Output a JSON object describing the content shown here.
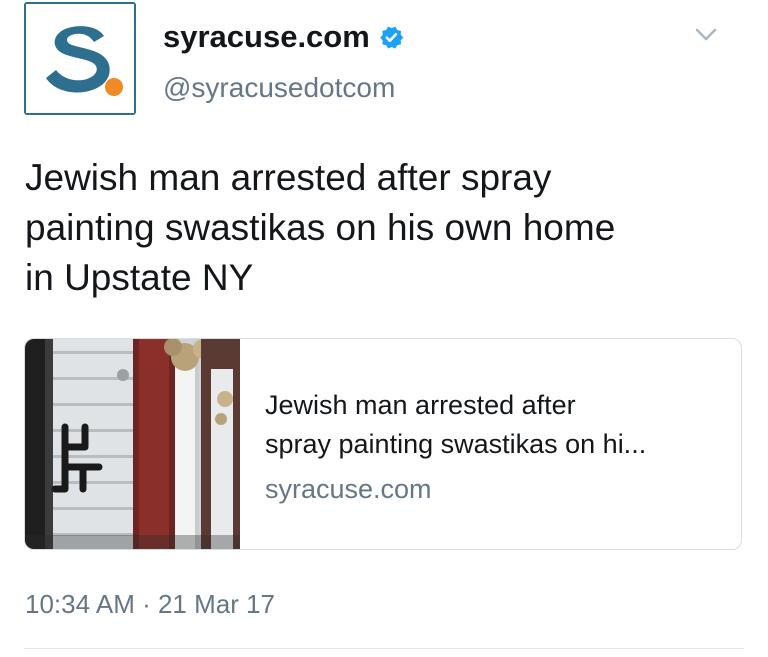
{
  "author": {
    "display_name": "syracuse.com",
    "handle": "@syracusedotcom",
    "verified": true,
    "avatar_icon": "syracuse-s-logo",
    "brand_color": "#2e6f8f",
    "accent_color": "#f08a24"
  },
  "tweet": {
    "text_lines": [
      "Jewish man arrested after spray",
      "painting swastikas on his own home",
      "in Upstate NY"
    ],
    "timestamp": "10:34 AM · 21 Mar 17"
  },
  "card": {
    "title_lines": [
      "Jewish man arrested after",
      "spray painting swastikas on hi..."
    ],
    "domain": "syracuse.com",
    "image_icon": "house-with-graffiti-photo"
  },
  "icons": {
    "verified": "verified-badge-icon",
    "menu": "chevron-down-icon"
  },
  "colors": {
    "verified_blue": "#1da1f2",
    "secondary_text": "#657786",
    "primary_text": "#14171a"
  }
}
